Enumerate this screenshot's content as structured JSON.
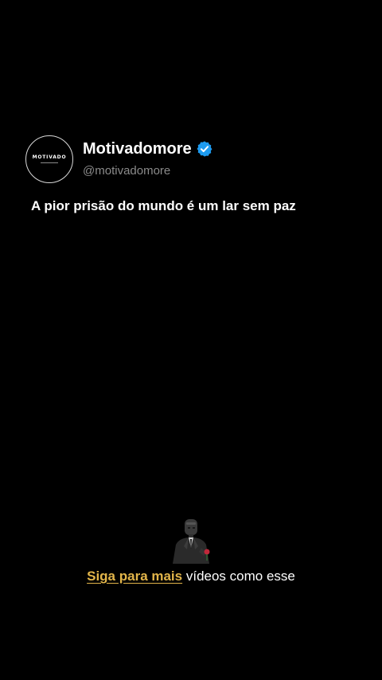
{
  "profile": {
    "avatar_text": "MOTIVADO",
    "display_name": "Motivadomore",
    "handle": "@motivadomore",
    "verified": true,
    "verified_color": "#1d9bf0"
  },
  "post": {
    "text": "A pior prisão do mundo é um lar sem paz"
  },
  "footer": {
    "follow_link": "Siga para mais",
    "follow_rest": " vídeos como esse",
    "link_color": "#e2b54a",
    "figure_icon": "suited-figure-icon"
  }
}
